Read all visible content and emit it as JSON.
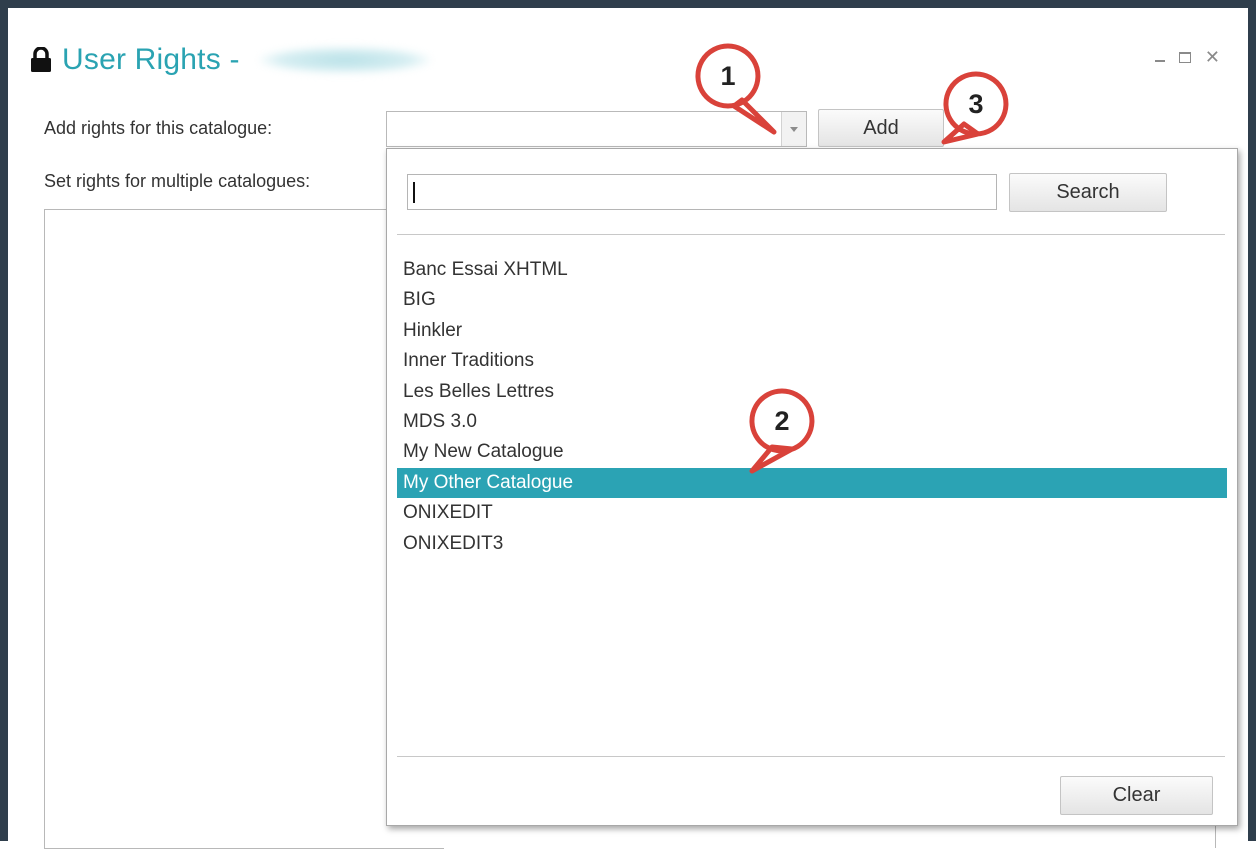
{
  "window": {
    "title": "User Rights - ",
    "controls": [
      "minimize",
      "maximize",
      "close"
    ]
  },
  "labels": {
    "add_rights": "Add rights for this catalogue:",
    "set_rights_multiple": "Set rights for multiple catalogues:"
  },
  "catalogue_select": {
    "value": ""
  },
  "buttons": {
    "add": "Add",
    "search": "Search",
    "clear": "Clear"
  },
  "search": {
    "value": ""
  },
  "catalogues": [
    {
      "label": "Banc Essai XHTML",
      "selected": false
    },
    {
      "label": "BIG",
      "selected": false
    },
    {
      "label": "Hinkler",
      "selected": false
    },
    {
      "label": "Inner Traditions",
      "selected": false
    },
    {
      "label": "Les Belles Lettres",
      "selected": false
    },
    {
      "label": "MDS 3.0",
      "selected": false
    },
    {
      "label": "My New Catalogue",
      "selected": false
    },
    {
      "label": "My Other Catalogue",
      "selected": true
    },
    {
      "label": "ONIXEDIT",
      "selected": false
    },
    {
      "label": "ONIXEDIT3",
      "selected": false
    }
  ],
  "callouts": [
    {
      "number": "1"
    },
    {
      "number": "2"
    },
    {
      "number": "3"
    }
  ],
  "colors": {
    "accent": "#2aa3b2",
    "selection": "#2ba3b4",
    "callout_border": "#d9423a",
    "frame": "#2f3e4c"
  }
}
